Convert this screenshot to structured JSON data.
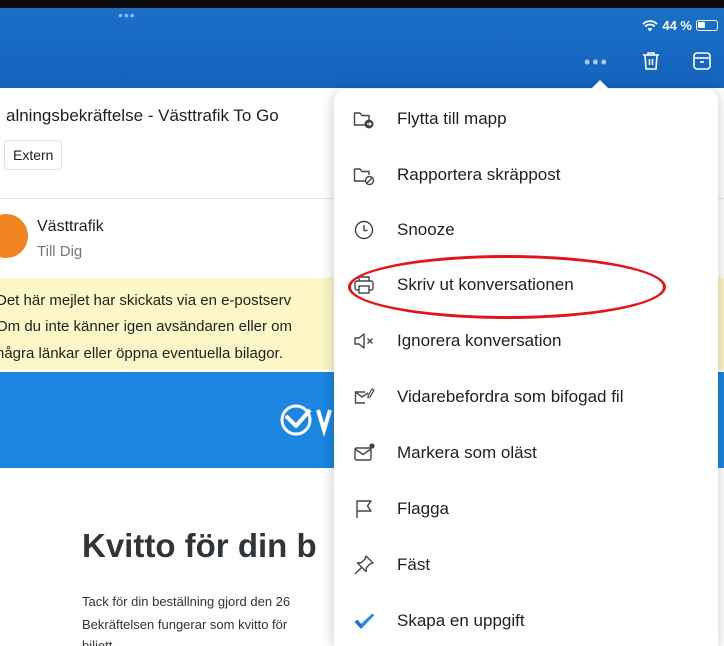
{
  "status_bar": {
    "battery": "44 %"
  },
  "email": {
    "subject": "alningsbekräftelse - Västtrafik To Go",
    "external_badge": "Extern",
    "sender": "Västtrafik",
    "recipient": "Till Dig",
    "warning_lines": [
      "Det här mejlet har skickats via en e-postserv",
      "Om du inte känner igen avsändaren eller om",
      "några länkar eller öppna eventuella bilagor."
    ],
    "content_title": "Kvitto för din b",
    "content_lines": [
      "Tack för din beställning gjord den 26",
      "Bekräftelsen fungerar som kvitto för",
      "biljett"
    ]
  },
  "menu": {
    "items": [
      {
        "label": "Flytta till mapp",
        "icon": "folder-move-icon"
      },
      {
        "label": "Rapportera skräppost",
        "icon": "folder-block-icon"
      },
      {
        "label": "Snooze",
        "icon": "clock-icon"
      },
      {
        "label": "Skriv ut konversationen",
        "icon": "printer-icon"
      },
      {
        "label": "Ignorera konversation",
        "icon": "mute-icon"
      },
      {
        "label": "Vidarebefordra som bifogad fil",
        "icon": "forward-attachment-icon"
      },
      {
        "label": "Markera som oläst",
        "icon": "mark-unread-icon"
      },
      {
        "label": "Flagga",
        "icon": "flag-icon"
      },
      {
        "label": "Fäst",
        "icon": "pin-icon"
      },
      {
        "label": "Skapa en uppgift",
        "icon": "checkmark-icon"
      }
    ]
  },
  "colors": {
    "header_blue": "#1a6fc6",
    "banner_blue": "#1a86e0",
    "warning_yellow": "#fdf6c6",
    "highlight_red": "#e2141c",
    "avatar_orange": "#f0851f",
    "task_check_blue": "#1f6fd0"
  }
}
